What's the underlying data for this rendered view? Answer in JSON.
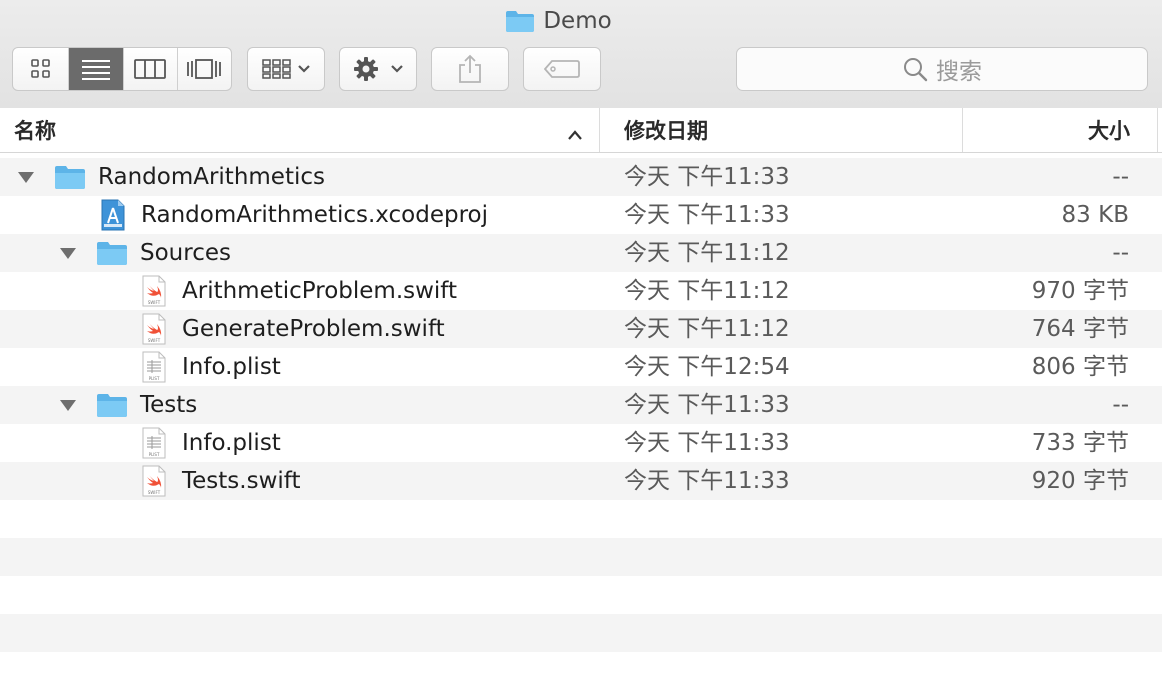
{
  "window": {
    "title": "Demo"
  },
  "toolbar": {
    "view_modes": [
      "icon-view",
      "list-view",
      "column-view",
      "cover-flow-view"
    ],
    "active_view": "list-view",
    "search_placeholder": "搜索"
  },
  "columns": {
    "name": "名称",
    "date": "修改日期",
    "size": "大小"
  },
  "rows": [
    {
      "name": "RandomArithmetics",
      "type": "folder",
      "level": 0,
      "expanded": true,
      "date": "今天 下午11:33",
      "size": "--"
    },
    {
      "name": "RandomArithmetics.xcodeproj",
      "type": "xcodeproj",
      "level": 1,
      "date": "今天 下午11:33",
      "size": "83 KB"
    },
    {
      "name": "Sources",
      "type": "folder",
      "level": 1,
      "expanded": true,
      "date": "今天 下午11:12",
      "size": "--"
    },
    {
      "name": "ArithmeticProblem.swift",
      "type": "swift",
      "level": 2,
      "date": "今天 下午11:12",
      "size": "970 字节"
    },
    {
      "name": "GenerateProblem.swift",
      "type": "swift",
      "level": 2,
      "date": "今天 下午11:12",
      "size": "764 字节"
    },
    {
      "name": "Info.plist",
      "type": "plist",
      "level": 2,
      "date": "今天 下午12:54",
      "size": "806 字节"
    },
    {
      "name": "Tests",
      "type": "folder",
      "level": 1,
      "expanded": true,
      "date": "今天 下午11:33",
      "size": "--"
    },
    {
      "name": "Info.plist",
      "type": "plist",
      "level": 2,
      "date": "今天 下午11:33",
      "size": "733 字节"
    },
    {
      "name": "Tests.swift",
      "type": "swift",
      "level": 2,
      "date": "今天 下午11:33",
      "size": "920 字节"
    }
  ],
  "colors": {
    "folder": "#6cc3f2",
    "selected_segment": "#6b6b6b",
    "swift": "#f05138"
  }
}
